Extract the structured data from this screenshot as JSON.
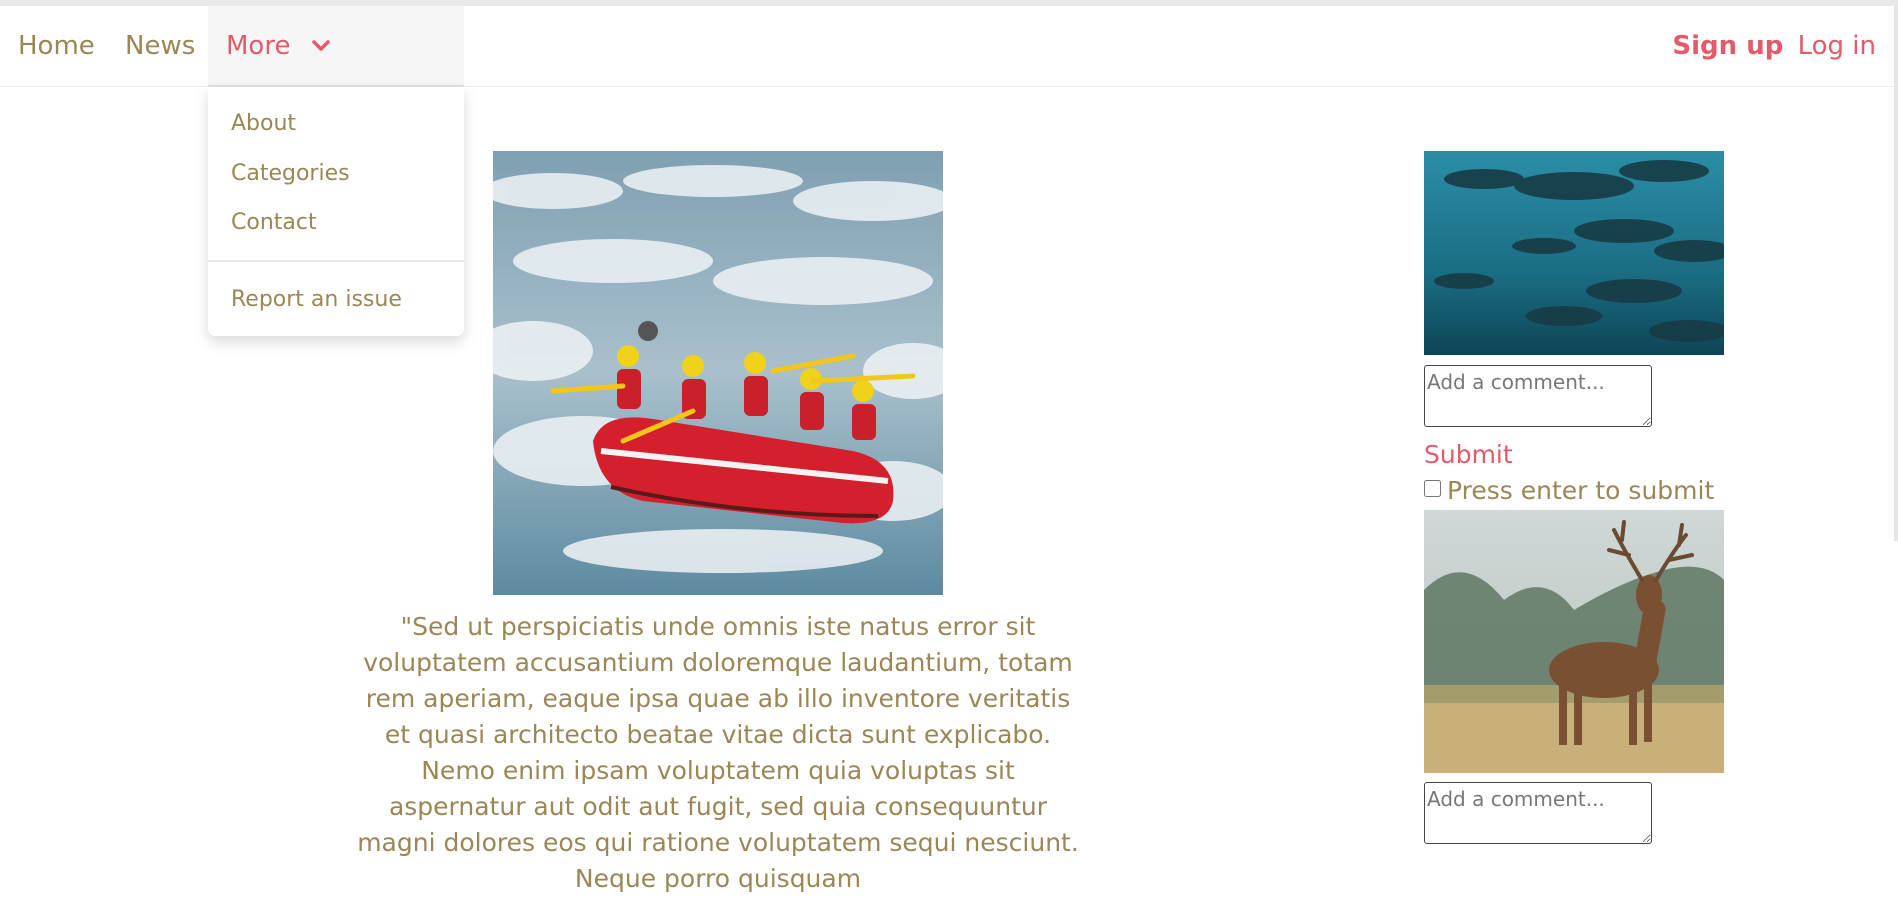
{
  "nav": {
    "home": "Home",
    "news": "News",
    "more": "More",
    "signup": "Sign up",
    "login": "Log in"
  },
  "dropdown": {
    "items": [
      "About",
      "Categories",
      "Contact"
    ],
    "report": "Report an issue"
  },
  "article": {
    "quote": "\"Sed ut perspiciatis unde omnis iste natus error sit voluptatem accusantium doloremque laudantium, totam rem aperiam, eaque ipsa quae ab illo inventore veritatis et quasi architecto beatae vitae dicta sunt explicabo. Nemo enim ipsam voluptatem quia voluptas sit aspernatur aut odit aut fugit, sed quia consequuntur magni dolores eos qui ratione voluptatem sequi nesciunt. Neque porro quisquam"
  },
  "sidebar": {
    "comment_placeholder": "Add a comment...",
    "submit": "Submit",
    "enter_label": "Press enter to submit"
  },
  "colors": {
    "accent": "#e45a69",
    "text": "#9b8655"
  }
}
